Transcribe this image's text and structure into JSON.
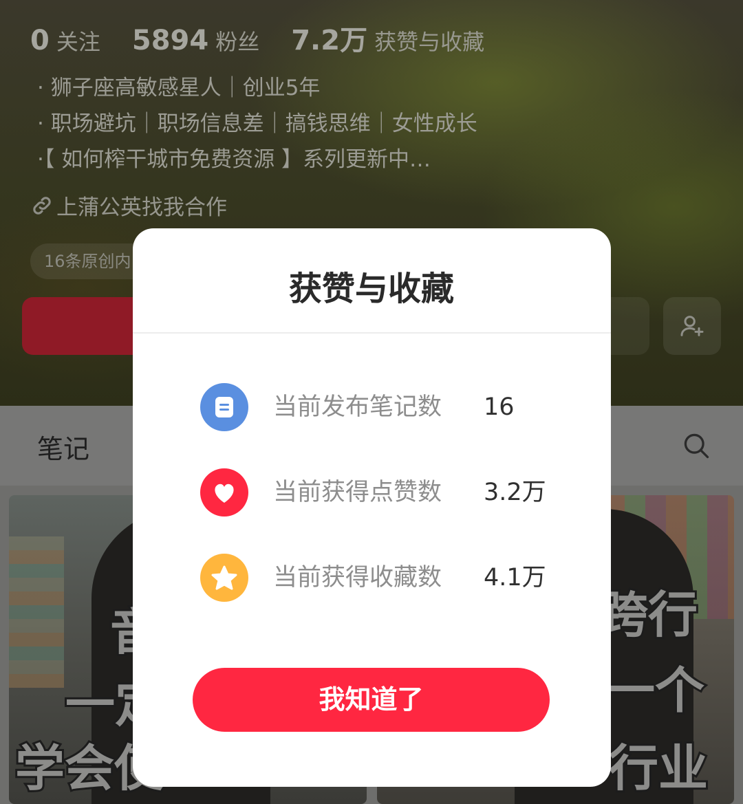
{
  "profile": {
    "stats": [
      {
        "value": "0",
        "label": "关注"
      },
      {
        "value": "5894",
        "label": "粉丝"
      },
      {
        "value": "7.2万",
        "label": "获赞与收藏"
      }
    ],
    "bio_lines": [
      "· 狮子座高敏感星人｜创业5年",
      "· 职场避坑｜职场信息差｜搞钱思维｜女性成长",
      "·【 如何榨干城市免费资源 】系列更新中…"
    ],
    "link_text": "上蒲公英找我合作",
    "original_tag": "16条原创内"
  },
  "tabs": {
    "notes": "笔记"
  },
  "cards": {
    "left_words": [
      "音",
      "一定",
      "学会使"
    ],
    "right_words": [
      "跨行",
      "一个",
      "行业"
    ]
  },
  "modal": {
    "title": "获赞与收藏",
    "rows": [
      {
        "icon": "note-icon",
        "label": "当前发布笔记数",
        "value": "16",
        "color": "#5a8fe0"
      },
      {
        "icon": "heart-icon",
        "label": "当前获得点赞数",
        "value": "3.2万",
        "color": "#ff2741"
      },
      {
        "icon": "star-icon",
        "label": "当前获得收藏数",
        "value": "4.1万",
        "color": "#ffb63d"
      }
    ],
    "confirm_label": "我知道了"
  },
  "colors": {
    "accent": "#ff2741",
    "note_blue": "#5a8fe0",
    "star_yellow": "#ffb63d"
  }
}
